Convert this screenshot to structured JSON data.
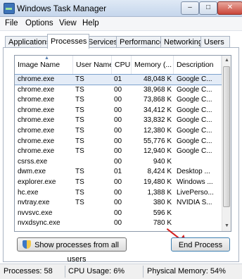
{
  "window": {
    "title": "Windows Task Manager",
    "controls": {
      "minimize": "–",
      "maximize": "□",
      "close": "✕"
    }
  },
  "menu": [
    "File",
    "Options",
    "View",
    "Help"
  ],
  "tabs": [
    "Applications",
    "Processes",
    "Services",
    "Performance",
    "Networking",
    "Users"
  ],
  "active_tab": "Processes",
  "columns": [
    "Image Name",
    "User Name",
    "CPU",
    "Memory (...",
    "Description"
  ],
  "sort_indicator": "▲",
  "processes": [
    {
      "name": "chrome.exe",
      "user": "TS",
      "cpu": "01",
      "mem": "48,048 K",
      "desc": "Google C..."
    },
    {
      "name": "chrome.exe",
      "user": "TS",
      "cpu": "00",
      "mem": "38,968 K",
      "desc": "Google C..."
    },
    {
      "name": "chrome.exe",
      "user": "TS",
      "cpu": "00",
      "mem": "73,868 K",
      "desc": "Google C..."
    },
    {
      "name": "chrome.exe",
      "user": "TS",
      "cpu": "00",
      "mem": "34,412 K",
      "desc": "Google C..."
    },
    {
      "name": "chrome.exe",
      "user": "TS",
      "cpu": "00",
      "mem": "33,832 K",
      "desc": "Google C..."
    },
    {
      "name": "chrome.exe",
      "user": "TS",
      "cpu": "00",
      "mem": "12,380 K",
      "desc": "Google C..."
    },
    {
      "name": "chrome.exe",
      "user": "TS",
      "cpu": "00",
      "mem": "55,776 K",
      "desc": "Google C..."
    },
    {
      "name": "chrome.exe",
      "user": "TS",
      "cpu": "00",
      "mem": "12,940 K",
      "desc": "Google C..."
    },
    {
      "name": "csrss.exe",
      "user": "",
      "cpu": "00",
      "mem": "940 K",
      "desc": ""
    },
    {
      "name": "dwm.exe",
      "user": "TS",
      "cpu": "01",
      "mem": "8,424 K",
      "desc": "Desktop ..."
    },
    {
      "name": "explorer.exe",
      "user": "TS",
      "cpu": "00",
      "mem": "19,480 K",
      "desc": "Windows ..."
    },
    {
      "name": "hc.exe",
      "user": "TS",
      "cpu": "00",
      "mem": "1,388 K",
      "desc": "LivePerso..."
    },
    {
      "name": "nvtray.exe",
      "user": "TS",
      "cpu": "00",
      "mem": "380 K",
      "desc": "NVIDIA S..."
    },
    {
      "name": "nvvsvc.exe",
      "user": "",
      "cpu": "00",
      "mem": "596 K",
      "desc": ""
    },
    {
      "name": "nvxdsync.exe",
      "user": "",
      "cpu": "00",
      "mem": "780 K",
      "desc": ""
    }
  ],
  "selected_row": 0,
  "buttons": {
    "show_all": "Show processes from all users",
    "end_process": "End Process"
  },
  "status": {
    "processes": "Processes: 58",
    "cpu": "CPU Usage: 6%",
    "memory": "Physical Memory: 54%"
  },
  "colors": {
    "selection": "#e4ecf7",
    "annotation_arrow": "#d21f1f"
  }
}
